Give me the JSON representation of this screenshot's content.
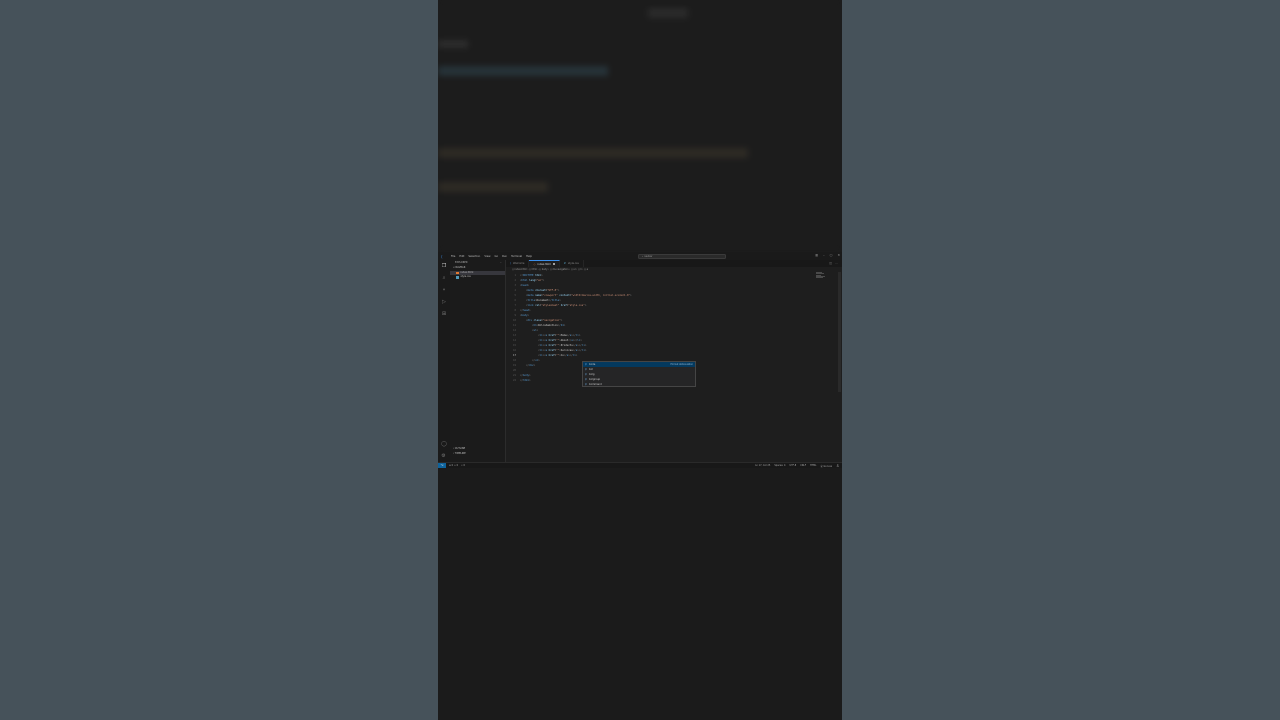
{
  "menu": [
    "File",
    "Edit",
    "Selection",
    "View",
    "Go",
    "Run",
    "Terminal",
    "Help"
  ],
  "command_center": "⌕ navbar",
  "explorer": {
    "title": "EXPLORER",
    "folder": "∨ NAVBAR",
    "files": [
      {
        "name": "index.html",
        "color": "#e37933"
      },
      {
        "name": "style.css",
        "color": "#519aba"
      }
    ],
    "outline": "› OUTLINE",
    "timeline": "› TIMELINE"
  },
  "tabs": [
    {
      "label": "Welcome",
      "icon": "vscode-icon"
    },
    {
      "label": "index.html",
      "icon": "html-icon",
      "modified": true
    },
    {
      "label": "style.css",
      "icon": "css-icon"
    }
  ],
  "breadcrumb": "⟨⟩ index.html › ⟨⟩ html › ⟨⟩ body › ⟨⟩ div.navigation › ⟨⟩ ul › ⟨⟩ li › ⟨⟩ a",
  "code_lines": [
    {
      "n": "1",
      "html": "<span class='tok-punc'>&lt;!</span><span class='tok-tag'>DOCTYPE</span> <span class='tok-attr'>html</span><span class='tok-punc'>&gt;</span>"
    },
    {
      "n": "2",
      "html": "<span class='tok-punc'>&lt;</span><span class='tok-tag'>html</span> <span class='tok-attr'>lang</span><span class='tok-txt'>=</span><span class='tok-str'>\"en\"</span><span class='tok-punc'>&gt;</span>"
    },
    {
      "n": "3",
      "html": "<span class='tok-punc'>&lt;</span><span class='tok-tag'>head</span><span class='tok-punc'>&gt;</span>"
    },
    {
      "n": "4",
      "html": "    <span class='tok-punc'>&lt;</span><span class='tok-tag'>meta</span> <span class='tok-attr'>charset</span><span class='tok-txt'>=</span><span class='tok-str'>\"UTF-8\"</span><span class='tok-punc'>&gt;</span>"
    },
    {
      "n": "5",
      "html": "    <span class='tok-punc'>&lt;</span><span class='tok-tag'>meta</span> <span class='tok-attr'>name</span><span class='tok-txt'>=</span><span class='tok-str'>\"viewport\"</span> <span class='tok-attr'>content</span><span class='tok-txt'>=</span><span class='tok-str'>\"width=device-width, initial-scale=1.0\"</span><span class='tok-punc'>&gt;</span>"
    },
    {
      "n": "6",
      "html": "    <span class='tok-punc'>&lt;</span><span class='tok-tag'>title</span><span class='tok-punc'>&gt;</span><span class='tok-txt'>Document</span><span class='tok-punc'>&lt;/</span><span class='tok-tag'>title</span><span class='tok-punc'>&gt;</span>"
    },
    {
      "n": "7",
      "html": "    <span class='tok-punc'>&lt;</span><span class='tok-tag'>link</span> <span class='tok-attr'>rel</span><span class='tok-txt'>=</span><span class='tok-str'>\"stylesheet\"</span> <span class='tok-attr'>href</span><span class='tok-txt'>=</span><span class='tok-str'>\"style.css\"</span><span class='tok-punc'>&gt;</span>"
    },
    {
      "n": "8",
      "html": "<span class='tok-punc'>&lt;/</span><span class='tok-tag'>head</span><span class='tok-punc'>&gt;</span>"
    },
    {
      "n": "9",
      "html": "<span class='tok-punc'>&lt;</span><span class='tok-tag'>body</span><span class='tok-punc'>&gt;</span>"
    },
    {
      "n": "10",
      "html": "    <span class='tok-punc'>&lt;</span><span class='tok-tag'>div</span> <span class='tok-attr'>class</span><span class='tok-txt'>=</span><span class='tok-str'>\"navigation\"</span><span class='tok-punc'>&gt;</span>"
    },
    {
      "n": "11",
      "html": "        <span class='tok-punc'>&lt;</span><span class='tok-tag'>h1</span><span class='tok-punc'>&gt;</span><span class='tok-txt'>Wilcodemotion</span><span class='tok-punc'>&lt;/</span><span class='tok-tag'>h1</span><span class='tok-punc'>&gt;</span>"
    },
    {
      "n": "12",
      "html": "        <span class='tok-punc'>&lt;</span><span class='tok-tag'>ul</span><span class='tok-punc'>&gt;</span>"
    },
    {
      "n": "13",
      "html": "            <span class='tok-punc'>&lt;</span><span class='tok-tag'>li</span><span class='tok-punc'>&gt;&lt;</span><span class='tok-tag'>a</span> <span class='tok-attr'>href</span><span class='tok-txt'>=</span><span class='tok-str'>\"\"</span><span class='tok-punc'>&gt;</span><span class='tok-txt'>Home</span><span class='tok-punc'>&lt;/</span><span class='tok-tag'>a</span><span class='tok-punc'>&gt;&lt;/</span><span class='tok-tag'>li</span><span class='tok-punc'>&gt;</span>"
    },
    {
      "n": "14",
      "html": "            <span class='tok-punc'>&lt;</span><span class='tok-tag'>li</span><span class='tok-punc'>&gt;&lt;</span><span class='tok-tag'>a</span> <span class='tok-attr'>href</span><span class='tok-txt'>=</span><span class='tok-str'>\"\"</span><span class='tok-punc'>&gt;</span><span class='tok-txt'>About</span><span class='tok-punc'>&lt;/</span><span class='tok-tag'>a</span><span class='tok-punc'>&gt;&lt;/</span><span class='tok-tag'>li</span><span class='tok-punc'>&gt;</span>"
    },
    {
      "n": "15",
      "html": "            <span class='tok-punc'>&lt;</span><span class='tok-tag'>li</span><span class='tok-punc'>&gt;&lt;</span><span class='tok-tag'>a</span> <span class='tok-attr'>href</span><span class='tok-txt'>=</span><span class='tok-str'>\"\"</span><span class='tok-punc'>&gt;</span><span class='tok-txt'>Products</span><span class='tok-punc'>&lt;/</span><span class='tok-tag'>a</span><span class='tok-punc'>&gt;&lt;/</span><span class='tok-tag'>li</span><span class='tok-punc'>&gt;</span>"
    },
    {
      "n": "16",
      "html": "            <span class='tok-punc'>&lt;</span><span class='tok-tag'>li</span><span class='tok-punc'>&gt;&lt;</span><span class='tok-tag'>a</span> <span class='tok-attr'>href</span><span class='tok-txt'>=</span><span class='tok-str'>\"\"</span><span class='tok-punc'>&gt;</span><span class='tok-txt'>Services</span><span class='tok-punc'>&lt;/</span><span class='tok-tag'>a</span><span class='tok-punc'>&gt;&lt;/</span><span class='tok-tag'>li</span><span class='tok-punc'>&gt;</span>"
    },
    {
      "n": "17",
      "html": "            <span class='tok-punc'>&lt;</span><span class='tok-tag'>li</span><span class='tok-punc'>&gt;&lt;</span><span class='tok-tag'>a</span> <span class='tok-attr'>href</span><span class='tok-txt'>=</span><span class='tok-str'>\"\"</span><span class='tok-punc'>&gt;</span><span class='tok-txt'>Co</span><span class='tok-punc'>&lt;/</span><span class='tok-tag'>a</span><span class='tok-punc'>&gt;&lt;/</span><span class='tok-tag'>li</span><span class='tok-punc'>&gt;</span>",
      "current": true
    },
    {
      "n": "18",
      "html": "        <span class='tok-punc'>&lt;/</span><span class='tok-tag'>ul</span><span class='tok-punc'>&gt;</span>"
    },
    {
      "n": "19",
      "html": "    <span class='tok-punc'>&lt;/</span><span class='tok-tag'>div</span><span class='tok-punc'>&gt;</span>"
    },
    {
      "n": "20",
      "html": ""
    },
    {
      "n": "21",
      "html": "<span class='tok-punc'>&lt;/</span><span class='tok-tag'>body</span><span class='tok-punc'>&gt;</span>"
    },
    {
      "n": "22",
      "html": "<span class='tok-punc'>&lt;/</span><span class='tok-tag'>html</span><span class='tok-punc'>&gt;</span>"
    }
  ],
  "suggestions": [
    {
      "label": "Code",
      "detail": "Emmet Abbreviation",
      "selected": true
    },
    {
      "label": "Col",
      "detail": ""
    },
    {
      "label": "Colg",
      "detail": ""
    },
    {
      "label": "Colgroup",
      "detail": ""
    },
    {
      "label": "Command",
      "detail": ""
    }
  ],
  "status": {
    "remote": "⌥",
    "errors": "⊗ 0 ⚠ 0",
    "ports": "⚡ 0",
    "position": "Ln 17, Col 25",
    "spaces": "Spaces: 4",
    "encoding": "UTF-8",
    "eol": "CRLF",
    "language": "HTML",
    "golive": "⦿ Go Live",
    "bell": "🔔︎"
  }
}
